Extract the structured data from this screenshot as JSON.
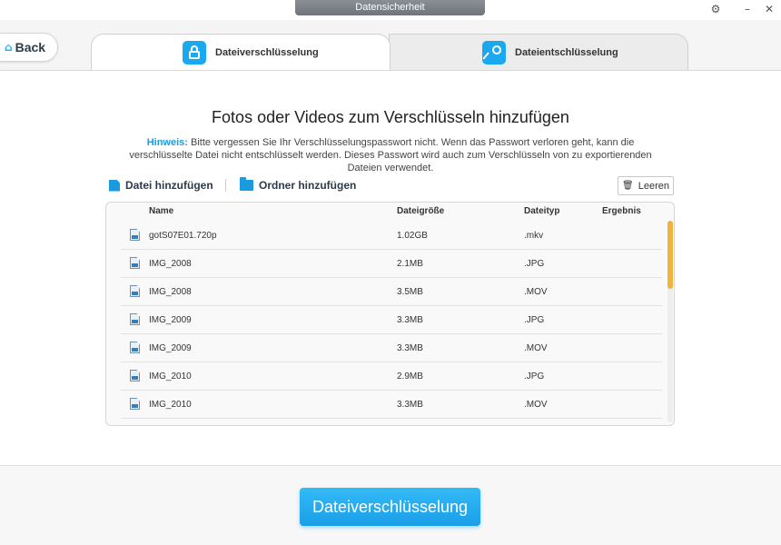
{
  "window": {
    "title": "Datensicherheit"
  },
  "nav": {
    "back_label": "Back"
  },
  "tabs": [
    {
      "label": "Dateiverschlüsselung",
      "icon": "lock-icon",
      "active": true
    },
    {
      "label": "Dateientschlüsselung",
      "icon": "key-icon",
      "active": false
    }
  ],
  "main": {
    "title": "Fotos oder Videos zum Verschlüsseln hinzufügen",
    "hint_label": "Hinweis:",
    "hint_text": " Bitte vergessen Sie Ihr Verschlüsselungspasswort nicht. Wenn das Passwort verloren geht, kann die verschlüsselte Datei nicht entschlüsselt werden. Dieses Passwort wird auch zum Verschlüsseln von zu exportierenden Dateien verwendet."
  },
  "toolbar": {
    "add_file": "Datei hinzufügen",
    "add_folder": "Ordner hinzufügen",
    "clear": "Leeren"
  },
  "table": {
    "columns": [
      "Name",
      "Dateigröße",
      "Dateityp",
      "Ergebnis"
    ],
    "rows": [
      {
        "name": "gotS07E01.720p",
        "size": "1.02GB",
        "type": ".mkv",
        "result": ""
      },
      {
        "name": "IMG_2008",
        "size": "2.1MB",
        "type": ".JPG",
        "result": ""
      },
      {
        "name": "IMG_2008",
        "size": "3.5MB",
        "type": ".MOV",
        "result": ""
      },
      {
        "name": "IMG_2009",
        "size": "3.3MB",
        "type": ".JPG",
        "result": ""
      },
      {
        "name": "IMG_2009",
        "size": "3.3MB",
        "type": ".MOV",
        "result": ""
      },
      {
        "name": "IMG_2010",
        "size": "2.9MB",
        "type": ".JPG",
        "result": ""
      },
      {
        "name": "IMG_2010",
        "size": "3.3MB",
        "type": ".MOV",
        "result": ""
      }
    ]
  },
  "footer": {
    "primary_label": "Dateiverschlüsselung"
  },
  "colors": {
    "accent": "#1aa8ef",
    "scrollbar": "#f0b43c"
  }
}
